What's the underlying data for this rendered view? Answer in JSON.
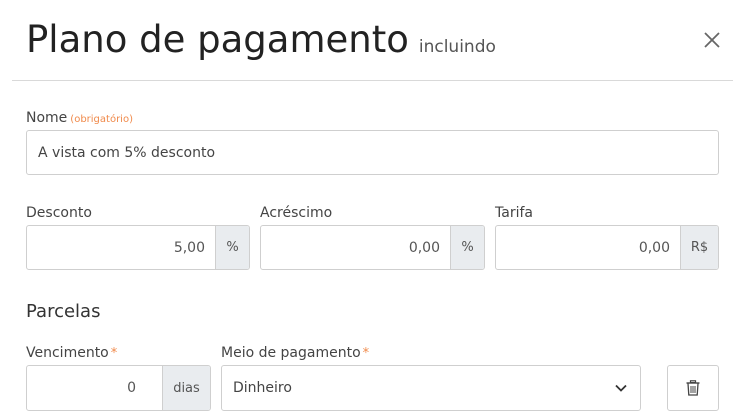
{
  "header": {
    "title": "Plano de pagamento",
    "subtitle": "incluindo",
    "close_icon": "close-icon"
  },
  "form": {
    "nome": {
      "label": "Nome",
      "required_note": "(obrigatório)",
      "value": "A vista com 5% desconto"
    },
    "desconto": {
      "label": "Desconto",
      "value": "5,00",
      "addon": "%"
    },
    "acrescimo": {
      "label": "Acréscimo",
      "value": "0,00",
      "addon": "%"
    },
    "tarifa": {
      "label": "Tarifa",
      "value": "0,00",
      "addon": "R$"
    }
  },
  "parcelas": {
    "title": "Parcelas",
    "vencimento": {
      "label": "Vencimento",
      "required_mark": "*",
      "value": "0",
      "addon": "dias"
    },
    "meio_pagamento": {
      "label": "Meio de pagamento",
      "required_mark": "*",
      "selected": "Dinheiro",
      "icon": "chevron-down-icon"
    },
    "delete_icon": "trash-icon"
  },
  "colors": {
    "required": "#f08a4b",
    "addon_bg": "#e9ecef",
    "border": "#cfcfcf"
  }
}
